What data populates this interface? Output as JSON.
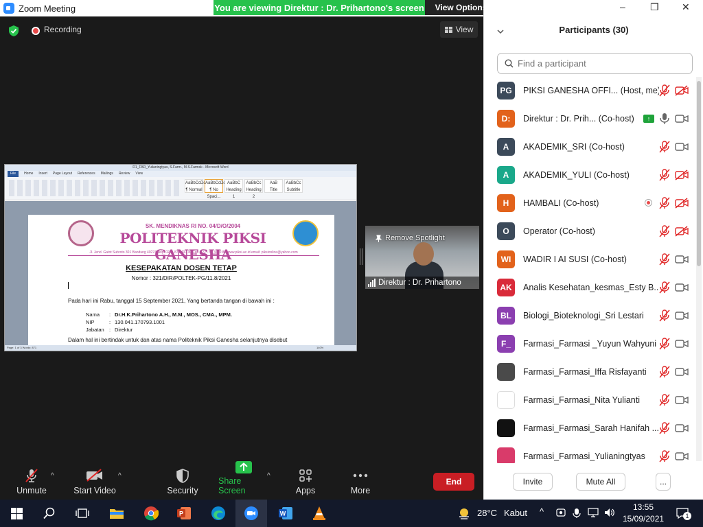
{
  "window": {
    "title": "Zoom Meeting",
    "share_banner": "You are viewing Direktur : Dr. Prihartono's screen",
    "view_options": "View Options"
  },
  "meeting": {
    "recording_label": "Recording",
    "view_label": "View"
  },
  "shared_document": {
    "window_title": "D1_FAR_Yulianingtyas, S.Farm., M.S.Farmsk - Microsoft Word",
    "menu": [
      "File",
      "Home",
      "Insert",
      "Page Layout",
      "References",
      "Mailings",
      "Review",
      "View"
    ],
    "styles": [
      "AaBbCcDd",
      "AaBbCcDd",
      "AaBbC",
      "AaBbCc",
      "AaB",
      "AaBbCc"
    ],
    "style_names": [
      "¶ Normal",
      "¶ No Spaci...",
      "Heading 1",
      "Heading 2",
      "Title",
      "Subtitle"
    ],
    "sk_line": "SK. MENDIKNAS RI NO. 04/D/O/2004",
    "institution": "POLITEKNIK PIKSI GANESHA",
    "address": "Jl. Jend. Gatot Subroto 301 Bandung 40274 Telp. 022 - 87 3400 30 Fax. 022 - 87 3400 86 www.piksi.ac.id email: piksionline@yahoo.com",
    "heading": "KESEPAKATAN DOSEN TETAP",
    "number": "Nomor : 321/DIR/POLTEK-PG/11.8/2021",
    "paragraph": "Pada hari ini Rabu, tanggal 15 September 2021,  Yang bertanda tangan di bawah ini :",
    "fields": [
      {
        "key": "Nama",
        "value": "Dr.H.K.Prihartono A.H.,  M.M., MOS., CMA., MPM."
      },
      {
        "key": "NIP",
        "value": "130.041.170793.1001"
      },
      {
        "key": "Jabatan",
        "value": "Direktur"
      }
    ],
    "paragraph2": "Dalam hal ini bertindak untuk dan atas nama Politeknik Piksi Ganesha selanjutnya disebut",
    "status_left": "Page: 1 of 3    Words: 871",
    "zoom": "140%"
  },
  "spotlight": {
    "remove_label": "Remove Spotlight",
    "name": "Direktur : Dr. Prihartono"
  },
  "toolbar": {
    "unmute": "Unmute",
    "start_video": "Start Video",
    "security": "Security",
    "share_screen": "Share Screen",
    "apps": "Apps",
    "more": "More",
    "end": "End"
  },
  "participants": {
    "title": "Participants (30)",
    "search_placeholder": "Find a participant",
    "invite": "Invite",
    "mute_all": "Mute All",
    "more": "...",
    "list": [
      {
        "initials": "PG",
        "color": "#3c4a5a",
        "name": "PIKSI GANESHA OFFI...  (Host, me)",
        "mic": "muted",
        "video": "off"
      },
      {
        "initials": "D:",
        "color": "#e2621b",
        "name": "Direktur : Dr. Prih...   (Co-host)",
        "mic": "on",
        "video": "on",
        "sharing": true
      },
      {
        "initials": "A",
        "color": "#3c4a5a",
        "name": "AKADEMIK_SRI (Co-host)",
        "mic": "muted",
        "video": "on"
      },
      {
        "initials": "A",
        "color": "#1aa88a",
        "name": "AKADEMIK_YULI (Co-host)",
        "mic": "muted",
        "video": "off"
      },
      {
        "initials": "H",
        "color": "#e2621b",
        "name": "HAMBALI (Co-host)",
        "mic": "muted",
        "video": "off",
        "recording": true
      },
      {
        "initials": "O",
        "color": "#3c4a5a",
        "name": "Operator (Co-host)",
        "mic": "muted",
        "video": "off"
      },
      {
        "initials": "WI",
        "color": "#e2621b",
        "name": "WADIR I AI SUSI (Co-host)",
        "mic": "muted",
        "video": "on"
      },
      {
        "initials": "AK",
        "color": "#d92b3a",
        "name": "Analis Kesehatan_kesmas_Esty B...",
        "mic": "muted",
        "video": "on"
      },
      {
        "initials": "BL",
        "color": "#8b3fb0",
        "name": "Biologi_Bioteknologi_Sri Lestari",
        "mic": "muted",
        "video": "on"
      },
      {
        "initials": "F_",
        "color": "#8b3fb0",
        "name": "Farmasi_Farmasi _Yuyun Wahyuni",
        "mic": "muted",
        "video": "on"
      },
      {
        "initials": "",
        "color": "#4a4a4a",
        "name": "Farmasi_Farmasi_Iffa Risfayanti",
        "mic": "muted",
        "video": "on",
        "photo": true
      },
      {
        "initials": "",
        "color": "#ffffff",
        "name": "Farmasi_Farmasi_Nita Yulianti",
        "mic": "muted",
        "video": "on",
        "photo": true
      },
      {
        "initials": "",
        "color": "#111111",
        "name": "Farmasi_Farmasi_Sarah Hanifah ...",
        "mic": "muted",
        "video": "on",
        "photo": true
      },
      {
        "initials": "",
        "color": "#d93b6a",
        "name": "Farmasi_Farmasi_Yulianingtyas",
        "mic": "muted",
        "video": "on",
        "photo": true
      }
    ]
  },
  "taskbar": {
    "temperature": "28°C",
    "weather": "Kabut",
    "time": "13:55",
    "date": "15/09/2021",
    "notifications": "1"
  },
  "colors": {
    "banner_green": "#27c24c",
    "end_red": "#c91e24",
    "mute_red": "#e02828",
    "zoom_blue": "#2d8cff"
  }
}
